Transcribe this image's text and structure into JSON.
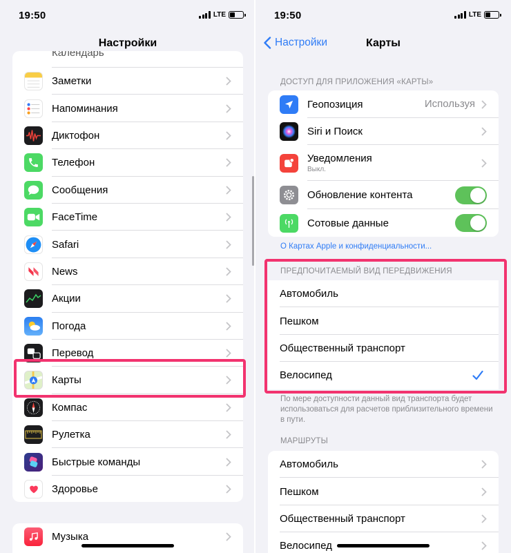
{
  "status": {
    "time": "19:50",
    "network": "LTE"
  },
  "left": {
    "title": "Настройки",
    "partial_item": "Календарь",
    "items": [
      {
        "label": "Заметки",
        "icon": "notes-icon"
      },
      {
        "label": "Напоминания",
        "icon": "reminders-icon"
      },
      {
        "label": "Диктофон",
        "icon": "voice-memos-icon"
      },
      {
        "label": "Телефон",
        "icon": "phone-icon"
      },
      {
        "label": "Сообщения",
        "icon": "messages-icon"
      },
      {
        "label": "FaceTime",
        "icon": "facetime-icon"
      },
      {
        "label": "Safari",
        "icon": "safari-icon"
      },
      {
        "label": "News",
        "icon": "news-icon"
      },
      {
        "label": "Акции",
        "icon": "stocks-icon"
      },
      {
        "label": "Погода",
        "icon": "weather-icon"
      },
      {
        "label": "Перевод",
        "icon": "translate-icon"
      },
      {
        "label": "Карты",
        "icon": "maps-icon"
      },
      {
        "label": "Компас",
        "icon": "compass-icon"
      },
      {
        "label": "Рулетка",
        "icon": "measure-icon"
      },
      {
        "label": "Быстрые команды",
        "icon": "shortcuts-icon"
      },
      {
        "label": "Здоровье",
        "icon": "health-icon"
      }
    ],
    "music": {
      "label": "Музыка",
      "icon": "music-icon"
    }
  },
  "right": {
    "back_label": "Настройки",
    "title": "Карты",
    "access_header": "ДОСТУП ДЛЯ ПРИЛОЖЕНИЯ «КАРТЫ»",
    "access": {
      "location": {
        "label": "Геопозиция",
        "value": "Используя"
      },
      "siri": {
        "label": "Siri и Поиск"
      },
      "notifications": {
        "label": "Уведомления",
        "sub": "Выкл."
      },
      "refresh": {
        "label": "Обновление контента",
        "on": true
      },
      "cellular": {
        "label": "Сотовые данные",
        "on": true
      }
    },
    "privacy_link": "О Картах Apple и конфиденциальности...",
    "transport_header": "ПРЕДПОЧИТАЕМЫЙ ВИД ПЕРЕДВИЖЕНИЯ",
    "transport": [
      {
        "label": "Автомобиль",
        "selected": false
      },
      {
        "label": "Пешком",
        "selected": false
      },
      {
        "label": "Общественный транспорт",
        "selected": false
      },
      {
        "label": "Велосипед",
        "selected": true
      }
    ],
    "transport_footer": "По мере доступности данный вид транспорта будет использоваться для расчетов приблизительного времени в пути.",
    "routes_header": "МАРШРУТЫ",
    "routes": [
      {
        "label": "Автомобиль"
      },
      {
        "label": "Пешком"
      },
      {
        "label": "Общественный транспорт"
      },
      {
        "label": "Велосипед"
      }
    ]
  },
  "colors": {
    "accent": "#2f7cf6",
    "highlight": "#f2336f",
    "toggle_on": "#5ec25a"
  }
}
